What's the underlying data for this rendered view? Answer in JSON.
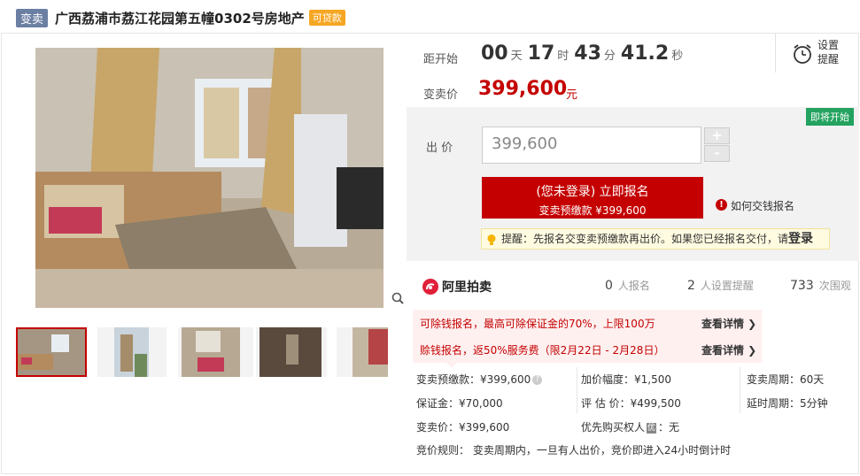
{
  "header": {
    "tag": "变卖",
    "title": "广西荔浦市荔江花园第五幢0302号房地产",
    "loan_tag": "可贷款"
  },
  "countdown": {
    "label": "距开始",
    "days": "00",
    "days_unit": "天",
    "hours": "17",
    "hours_unit": "时",
    "minutes": "43",
    "minutes_unit": "分",
    "seconds": "41.2",
    "seconds_unit": "秒"
  },
  "remind": {
    "line1": "设置",
    "line2": "提醒"
  },
  "price": {
    "label": "变卖价",
    "value": "399,600",
    "unit": "元"
  },
  "bid": {
    "status_badge": "即将开始",
    "label": "出 价",
    "input_value": "399,600",
    "plus": "+",
    "minus": "-",
    "signup_line1": "(您未登录) 立即报名",
    "signup_line2": "变卖预缴款 ¥399,600",
    "howto": "如何交钱报名",
    "tip_text": "提醒：先报名交变卖预缴款再出价。如果您已经报名交付，请",
    "tip_login": "登录"
  },
  "platform": {
    "logo_text": "阿里拍卖",
    "signups_count": "0",
    "signups_label": "人报名",
    "reminders_count": "2",
    "reminders_label": "人设置提醒",
    "views_count": "733",
    "views_label": "次围观"
  },
  "deductions": [
    {
      "text": "可除钱报名，最高可除保证金的70%，上限100万",
      "link": "查看详情 ❯"
    },
    {
      "text": "赊钱报名，返50%服务费（限2月22日 - 2月28日）",
      "link": "查看详情 ❯"
    }
  ],
  "details": {
    "prepay": "变卖预缴款：¥399,600",
    "increment": "加价幅度：¥1,500",
    "cycle": "变卖周期：60天",
    "deposit": "保证金：¥70,000",
    "estimate": "评 估 价：¥499,500",
    "delay": "延时周期：5分钟",
    "sale_price": "变卖价：¥399,600",
    "priority_label": "优先购买权人",
    "priority_badge": "优",
    "priority_value": "：无",
    "rules": "竞价规则： 变卖周期内，一旦有人出价，竞价即进入24小时倒计时"
  }
}
